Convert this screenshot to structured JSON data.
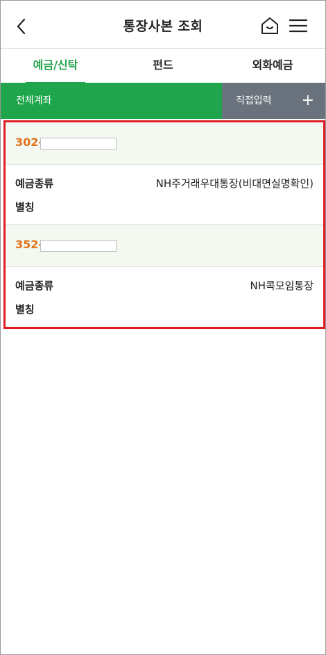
{
  "header": {
    "title": "통장사본 조회",
    "back_icon": "chevron-left-icon",
    "home_icon": "home-icon",
    "menu_icon": "hamburger-menu-icon"
  },
  "tabs": [
    {
      "label": "예금/신탁",
      "active": true
    },
    {
      "label": "펀드",
      "active": false
    },
    {
      "label": "외화예금",
      "active": false
    }
  ],
  "account_bar": {
    "all_label": "전체계좌",
    "direct_label": "직접입력",
    "plus": "+"
  },
  "colors": {
    "accent_green": "#1fa54b",
    "gray_button": "#6a737d",
    "account_number_orange": "#e2731b",
    "highlight_border": "#e01d25"
  },
  "accounts": [
    {
      "number_prefix": "302-",
      "type_label": "예금종류",
      "type_value": "NH주거래우대통장(비대면실명확인)",
      "nickname_label": "별칭"
    },
    {
      "number_prefix": "352-",
      "type_label": "예금종류",
      "type_value": "NH콕모임통장",
      "nickname_label": "별칭"
    }
  ]
}
